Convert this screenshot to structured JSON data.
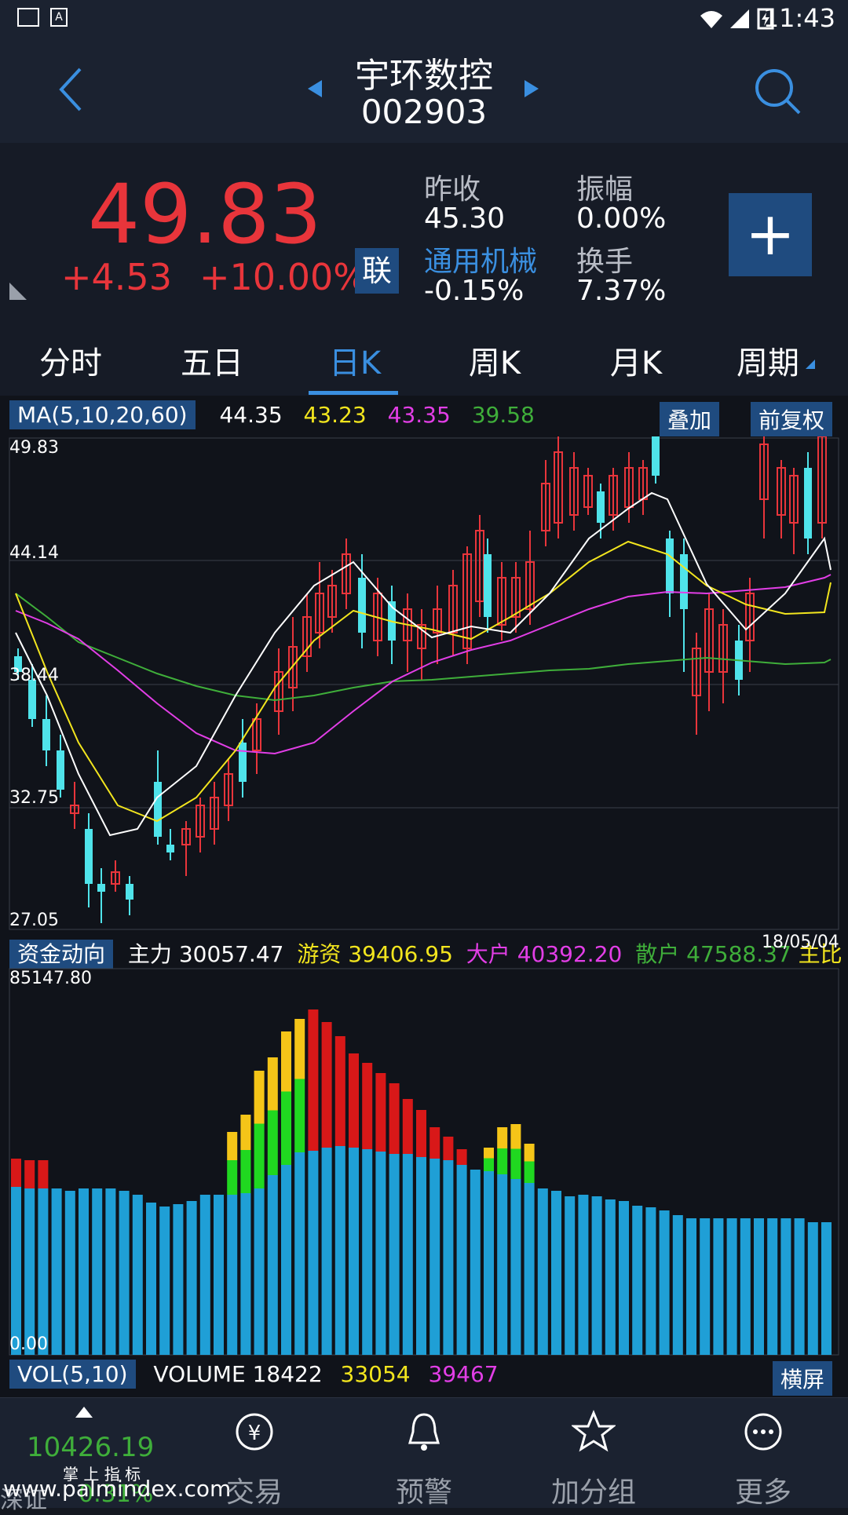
{
  "status": {
    "time": "11:43"
  },
  "header": {
    "name": "宇环数控",
    "code": "002903"
  },
  "quote": {
    "price": "49.83",
    "change": "+4.53",
    "change_pct": "+10.00%",
    "link_badge": "联",
    "prev_close_label": "昨收",
    "prev_close": "45.30",
    "amplitude_label": "振幅",
    "amplitude": "0.00%",
    "sector_label": "通用机械",
    "sector_change": "-0.15%",
    "turnover_label": "换手",
    "turnover": "7.37%",
    "add_symbol": "+"
  },
  "tabs": [
    "分时",
    "五日",
    "日K",
    "周K",
    "月K",
    "周期"
  ],
  "active_tab": 2,
  "ma_legend": {
    "label": "MA(5,10,20,60)",
    "values": [
      "44.35",
      "43.23",
      "43.35",
      "39.58"
    ],
    "colors": [
      "#ffffff",
      "#f2e51e",
      "#e23ee6",
      "#3fae3a"
    ],
    "overlay_button": "叠加",
    "adjust_button": "前复权"
  },
  "kline_axis": [
    "49.83",
    "44.14",
    "38.44",
    "32.75",
    "27.05"
  ],
  "fund_legend": {
    "label": "资金动向",
    "items": [
      {
        "name": "主力",
        "value": "30057.47",
        "color": "#ffffff"
      },
      {
        "name": "游资",
        "value": "39406.95",
        "color": "#f2e51e"
      },
      {
        "name": "大户",
        "value": "40392.20",
        "color": "#e23ee6"
      },
      {
        "name": "散户",
        "value": "47588.37",
        "color": "#3fae3a"
      }
    ],
    "extra": "主比",
    "date": "18/05/04"
  },
  "fund_axis": {
    "max": "85147.80",
    "min": "0.00"
  },
  "vol_legend": {
    "label": "VOL(5,10)",
    "volume_label": "VOLUME",
    "volume": "18422",
    "ma5": "33054",
    "ma10": "39467",
    "landscape_button": "横屏"
  },
  "bottom_nav": {
    "index_value": "10426.19",
    "index_change": "0.31%",
    "index_name": "深证",
    "caption": "掌 上 指 标",
    "watermark": "www.palmindex.com",
    "items": [
      "交易",
      "预警",
      "加分组",
      "更多"
    ]
  },
  "colors": {
    "up": "#e8353b",
    "down": "#4fe3ea",
    "accent": "#3a8fe0"
  }
}
